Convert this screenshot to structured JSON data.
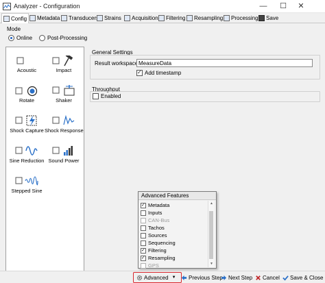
{
  "window": {
    "title": "Analyzer - Configuration",
    "controls": {
      "minimize": "—",
      "maximize": "☐",
      "close": "✕"
    }
  },
  "tabs": [
    {
      "label": "Config",
      "icon": "config-icon",
      "active": true
    },
    {
      "label": "Metadata",
      "icon": "metadata-icon"
    },
    {
      "label": "Transducers",
      "icon": "transducers-icon"
    },
    {
      "label": "Strains",
      "icon": "strains-icon"
    },
    {
      "label": "Acquisition",
      "icon": "acquisition-icon"
    },
    {
      "label": "Filtering",
      "icon": "filtering-icon"
    },
    {
      "label": "Resampling",
      "icon": "resampling-icon"
    },
    {
      "label": "Processing",
      "icon": "processing-icon"
    },
    {
      "label": "Save",
      "icon": "save-icon"
    }
  ],
  "mode": {
    "label": "Mode",
    "options": [
      {
        "label": "Online",
        "checked": true
      },
      {
        "label": "Post-Processing",
        "checked": false
      }
    ]
  },
  "tools": [
    {
      "label": "Acoustic",
      "icon": "acoustic-icon",
      "checked": false
    },
    {
      "label": "Impact",
      "icon": "hammer-icon",
      "checked": false
    },
    {
      "label": "Rotate",
      "icon": "rotate-icon",
      "checked": false
    },
    {
      "label": "Shaker",
      "icon": "shaker-icon",
      "checked": false
    },
    {
      "label": "Shock Capture",
      "icon": "shock-capture-icon",
      "checked": false
    },
    {
      "label": "Shock Response",
      "icon": "shock-response-icon",
      "checked": false
    },
    {
      "label": "Sine Reduction",
      "icon": "sine-reduction-icon",
      "checked": false
    },
    {
      "label": "Sound Power",
      "icon": "sound-power-icon",
      "checked": false
    },
    {
      "label": "Stepped Sine",
      "icon": "stepped-sine-icon",
      "checked": false
    }
  ],
  "general_settings": {
    "title": "General Settings",
    "result_workspace_label": "Result workspace",
    "result_workspace_value": "MeasureData",
    "add_timestamp_label": "Add timestamp",
    "add_timestamp_checked": true
  },
  "throughput": {
    "title": "Throughput",
    "enabled_label": "Enabled",
    "enabled_checked": false
  },
  "advanced_features": {
    "title": "Advanced Features",
    "items": [
      {
        "label": "Metadata",
        "checked": true,
        "disabled": false
      },
      {
        "label": "Inputs",
        "checked": false,
        "disabled": false
      },
      {
        "label": "CAN-Bus",
        "checked": false,
        "disabled": true
      },
      {
        "label": "Tachos",
        "checked": false,
        "disabled": false
      },
      {
        "label": "Sources",
        "checked": false,
        "disabled": false
      },
      {
        "label": "Sequencing",
        "checked": false,
        "disabled": false
      },
      {
        "label": "Filtering",
        "checked": true,
        "disabled": false
      },
      {
        "label": "Resampling",
        "checked": true,
        "disabled": false
      },
      {
        "label": "GPS",
        "checked": false,
        "disabled": true
      }
    ]
  },
  "bottom_bar": {
    "advanced_label": "Advanced",
    "previous_label": "Previous Step",
    "next_label": "Next Step",
    "cancel_label": "Cancel",
    "save_close_label": "Save & Close"
  },
  "colors": {
    "accent": "#1e5fbf",
    "highlight_border": "#d9262c",
    "arrow_blue": "#2a70c8",
    "cancel_red": "#c0282b"
  }
}
